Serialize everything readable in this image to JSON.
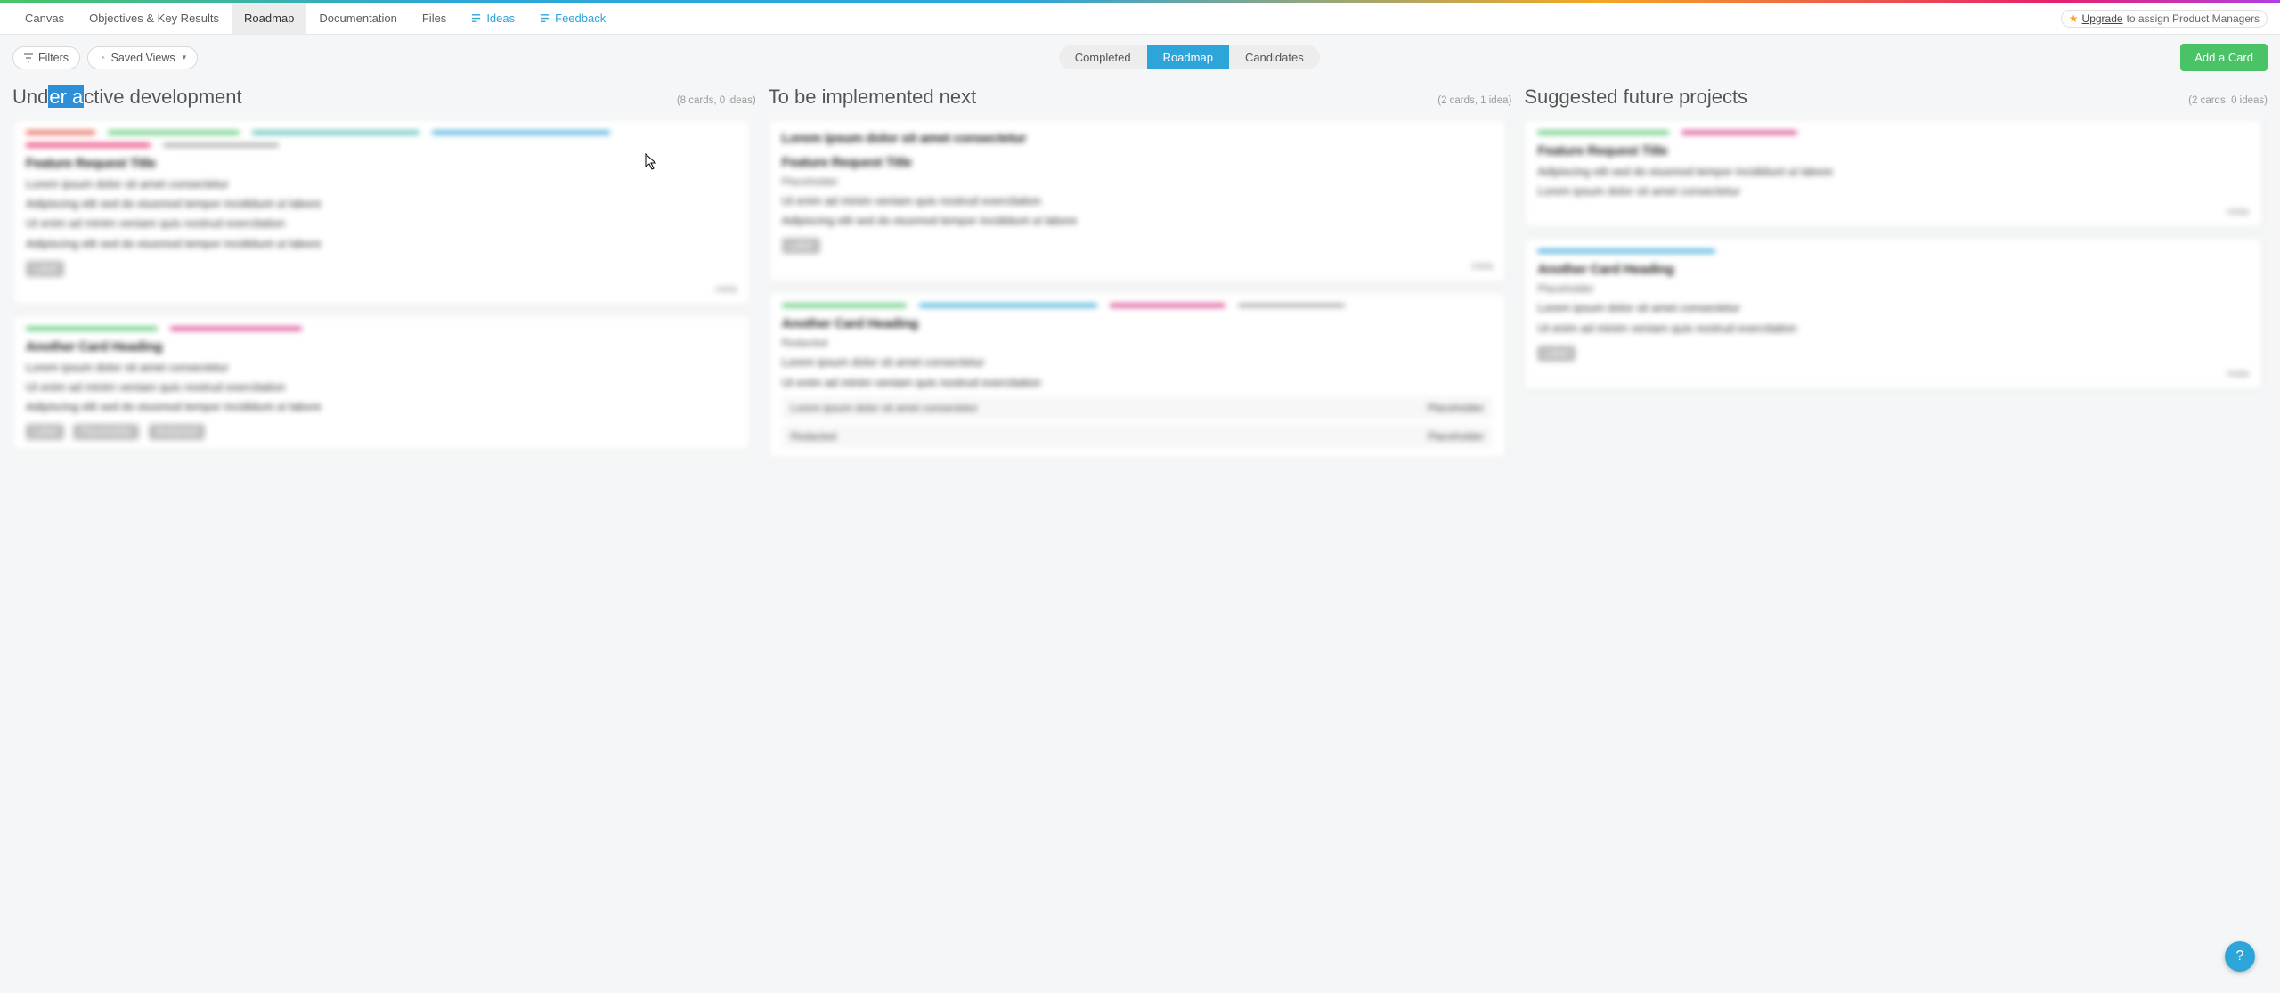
{
  "nav": {
    "tabs": {
      "canvas": "Canvas",
      "okr": "Objectives & Key Results",
      "roadmap": "Roadmap",
      "documentation": "Documentation",
      "files": "Files",
      "ideas": "Ideas",
      "feedback": "Feedback"
    },
    "upgrade": {
      "link": "Upgrade",
      "tail": "to assign Product Managers"
    }
  },
  "toolbar": {
    "filters": "Filters",
    "saved_views": "Saved Views",
    "segment": {
      "completed": "Completed",
      "roadmap": "Roadmap",
      "candidates": "Candidates"
    },
    "add_card": "Add a Card"
  },
  "columns": {
    "c1": {
      "title_pre": "Und",
      "title_hl": "er a",
      "title_post": "ctive development",
      "count": "(8 cards, 0 ideas)"
    },
    "c2": {
      "title": "To be implemented next",
      "count": "(2 cards, 1 idea)"
    },
    "c3": {
      "title": "Suggested future projects",
      "count": "(2 cards, 0 ideas)"
    }
  },
  "colors": {
    "red": "#e74c3c",
    "green": "#4ac367",
    "teal": "#3fb8af",
    "blue": "#2ea5d9",
    "pink": "#e6216a",
    "magenta": "#d63384",
    "grey": "#a0a0a0",
    "orange": "#f5a623"
  },
  "placeholder": {
    "line_a": "Lorem ipsum dolor sit amet consectetur",
    "line_b": "Adipiscing elit sed do eiusmod tempor incididunt ut labore",
    "line_c": "Ut enim ad minim veniam quis nostrud exercitation",
    "short_a": "Placeholder",
    "short_b": "Redacted",
    "heading_a": "Feature Request Title",
    "heading_b": "Another Card Heading",
    "chip": "Label",
    "footer": "meta"
  },
  "help": "?"
}
